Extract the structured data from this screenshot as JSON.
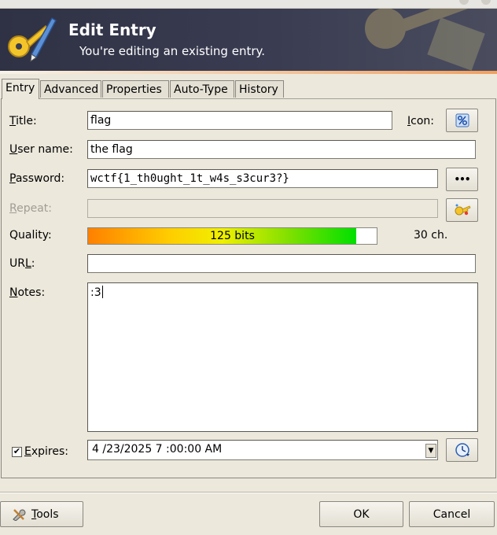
{
  "banner": {
    "title": "Edit Entry",
    "subtitle": "You're editing an existing entry."
  },
  "tabs": [
    {
      "label": "Entry",
      "active": true
    },
    {
      "label": "Advanced",
      "active": false
    },
    {
      "label": "Properties",
      "active": false
    },
    {
      "label": "Auto-Type",
      "active": false
    },
    {
      "label": "History",
      "active": false
    }
  ],
  "form": {
    "title_label_accel": "T",
    "title_label_rest": "itle:",
    "title_value": "flag",
    "icon_label_accel": "I",
    "icon_label_rest": "con:",
    "username_label_accel": "U",
    "username_label_rest": "ser name:",
    "username_value": "the flag",
    "password_label_accel": "P",
    "password_label_rest": "assword:",
    "password_value": "wctf{1_th0ught_1t_w4s_s3cur3?}",
    "password_toggle_label": "•••",
    "repeat_label_accel": "R",
    "repeat_label_rest": "epeat:",
    "repeat_value": "",
    "quality_label": "Quality:",
    "quality_bits": "125 bits",
    "quality_fraction": 0.93,
    "quality_chars": "30 ch.",
    "url_label_pre": "UR",
    "url_label_accel": "L",
    "url_label_post": ":",
    "url_value": "",
    "notes_label_accel": "N",
    "notes_label_rest": "otes:",
    "notes_value": ":3",
    "expires_checked": true,
    "expires_label_accel": "E",
    "expires_label_rest": "xpires:",
    "expires_value": "4 /23/2025  7 :00:00 AM"
  },
  "footer": {
    "tools_accel": "T",
    "tools_rest": "ools",
    "ok_label": "OK",
    "cancel_label": "Cancel"
  },
  "colors": {
    "banner": "#2f3144",
    "dialog_bg": "#ece8dc",
    "quality_start": "#ff8000",
    "quality_end": "#00e000"
  },
  "icons": {
    "banner": "key-pen-icon",
    "icon_picker": "percent-icon",
    "password_toggle": "dots-icon",
    "password_generator": "key-generator-icon",
    "expiry_picker": "clock-icon",
    "tools": "wrench-icon",
    "checkbox": "checkmark-icon",
    "dropdown": "triangle-down-icon"
  }
}
